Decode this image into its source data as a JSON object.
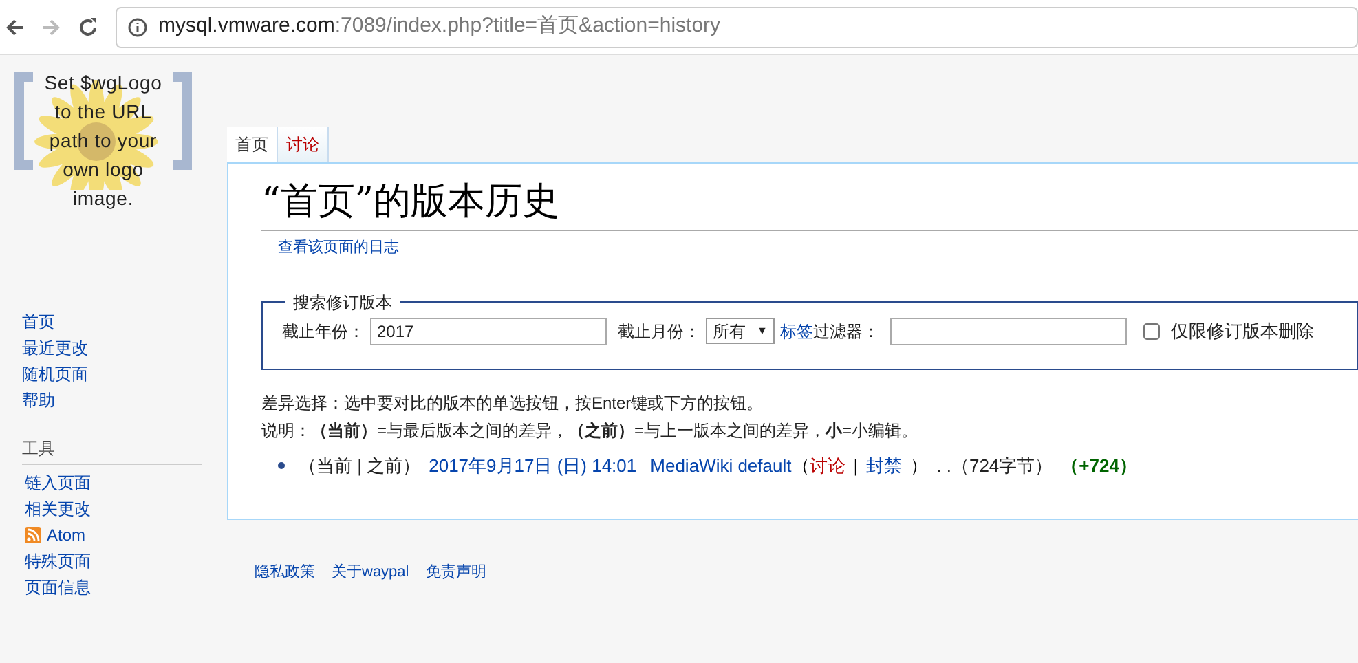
{
  "browser": {
    "url_host": "mysql.vmware.com",
    "url_rest": ":7089/index.php?title=首页&action=history"
  },
  "logo": {
    "text": "Set $wgLogo to the URL path to your own logo image."
  },
  "sidebar": {
    "nav": [
      "首页",
      "最近更改",
      "随机页面",
      "帮助"
    ],
    "tools_heading": "工具",
    "tools": [
      {
        "label": "链入页面",
        "kind": "link"
      },
      {
        "label": "相关更改",
        "kind": "link"
      },
      {
        "label": "Atom",
        "kind": "feed"
      },
      {
        "label": "特殊页面",
        "kind": "link"
      },
      {
        "label": "页面信息",
        "kind": "link"
      }
    ]
  },
  "tabs": [
    {
      "label": "首页",
      "selected": true
    },
    {
      "label": "讨论",
      "selected": false
    }
  ],
  "heading": "“首页”的版本历史",
  "log_link": "查看该页面的日志",
  "search": {
    "legend": "搜索修订版本",
    "year_label": "截止年份：",
    "year_value": "2017",
    "month_label": "截止月份：",
    "month_value": "所有",
    "month_arrow": "▼",
    "tag_link": "标签",
    "tag_label": "过滤器：",
    "deleted_label": "仅限修订版本删除",
    "deleted_checked": false
  },
  "hint": "差异选择：选中要对比的版本的单选按钮，按Enter键或下方的按钮。",
  "legend": "说明：**（当前）**=与最后版本之间的差异，**（之前）**=与上一版本之间的差异，**小**=小编辑。",
  "revisions": [
    {
      "cur_prev": "（当前 | 之前）",
      "date": "2017年9月17日 (日) 14:01",
      "user": "MediaWiki default",
      "open": "（",
      "talk": "讨论",
      "sep": "|",
      "block": "封禁",
      "close": "）",
      "size": ". .（724字节）",
      "diff": "（+724）"
    }
  ],
  "footer": [
    "隐私政策",
    "关于waypal",
    "免责声明"
  ]
}
